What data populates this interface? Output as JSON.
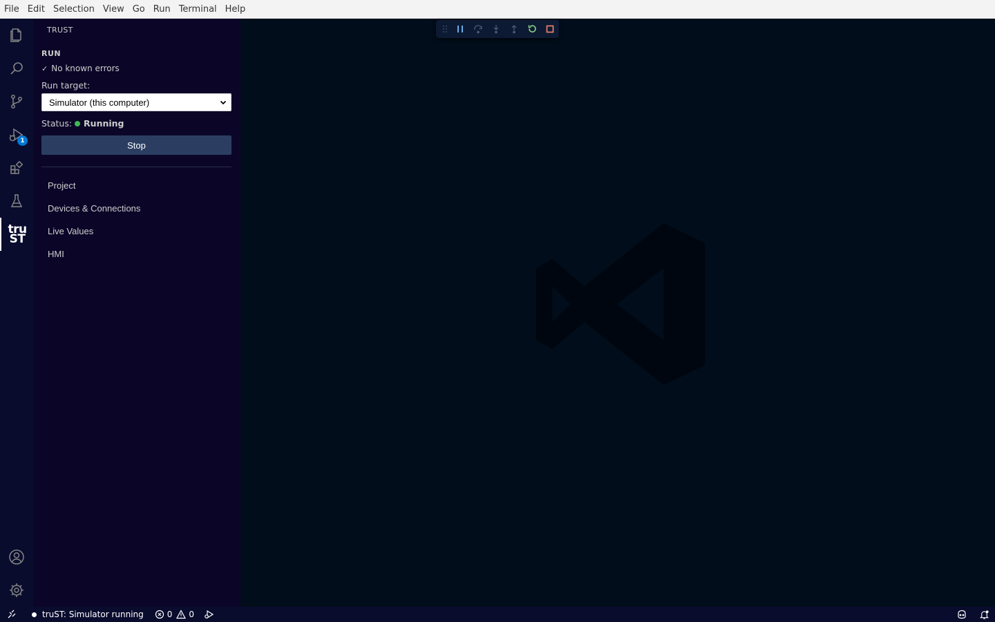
{
  "menu": [
    "File",
    "Edit",
    "Selection",
    "View",
    "Go",
    "Run",
    "Terminal",
    "Help"
  ],
  "activity_bar": {
    "items": [
      {
        "name": "explorer-icon"
      },
      {
        "name": "search-icon"
      },
      {
        "name": "source-control-icon"
      },
      {
        "name": "run-debug-icon",
        "badge": "1"
      },
      {
        "name": "extensions-icon"
      },
      {
        "name": "testing-icon"
      },
      {
        "name": "trust-icon",
        "logo_top": "tru",
        "logo_bottom": "ST"
      }
    ],
    "bottom": [
      {
        "name": "account-icon"
      },
      {
        "name": "settings-gear-icon"
      }
    ]
  },
  "sidebar": {
    "title": "TRUST",
    "section": "RUN",
    "check_mark": "✓",
    "errors_text": "No known errors",
    "run_target_label": "Run target:",
    "run_target_value": "Simulator (this computer)",
    "status_label": "Status:",
    "status_value": "Running",
    "status_color": "#3fb950",
    "stop_label": "Stop",
    "nav": [
      "Project",
      "Devices & Connections",
      "Live Values",
      "HMI"
    ]
  },
  "debug_toolbar": {
    "buttons": [
      "drag-handle-icon",
      "pause-icon",
      "step-over-icon",
      "step-into-icon",
      "step-out-icon",
      "restart-icon",
      "stop-icon"
    ]
  },
  "statusbar": {
    "session_text": "truST: Simulator running",
    "errors_count": "0",
    "warnings_count": "0"
  },
  "colors": {
    "accent": "#0078d4",
    "running": "#3fb950",
    "stop_debug": "#f48771",
    "restart_debug": "#89d185",
    "debug_blue": "#75beff"
  }
}
